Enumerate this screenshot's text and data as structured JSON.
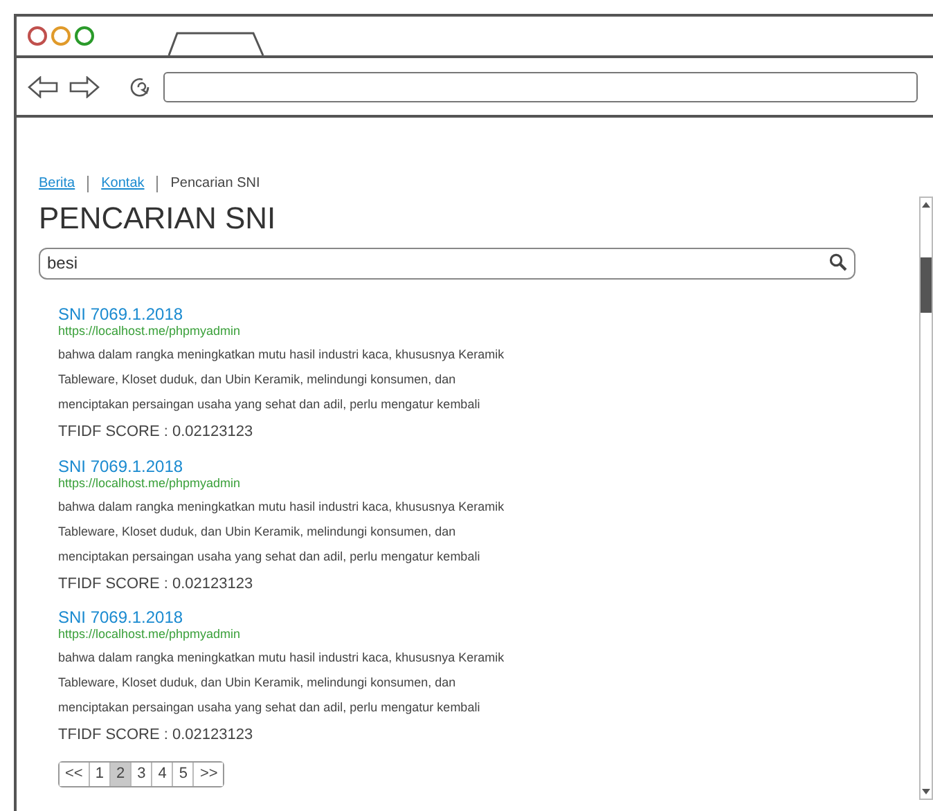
{
  "breadcrumb": [
    {
      "label": "Berita",
      "kind": "link"
    },
    {
      "label": "Kontak",
      "kind": "link"
    },
    {
      "label": "Pencarian SNI",
      "kind": "current"
    }
  ],
  "heading": "PENCARIAN SNI",
  "search": {
    "value": "besi"
  },
  "results": [
    {
      "title": "SNI 7069.1.2018",
      "url": "https://localhost.me/phpmyadmin",
      "snippet": "bahwa dalam rangka meningkatkan mutu hasil industri kaca, khususnya Keramik Tableware, Kloset duduk, dan Ubin Keramik, melindungi konsumen, dan menciptakan persaingan usaha yang sehat dan adil, perlu mengatur kembali",
      "score": "TFIDF SCORE : 0.02123123"
    },
    {
      "title": "SNI 7069.1.2018",
      "url": "https://localhost.me/phpmyadmin",
      "snippet": "bahwa dalam rangka meningkatkan mutu hasil industri kaca, khususnya Keramik Tableware, Kloset duduk, dan Ubin Keramik, melindungi konsumen, dan menciptakan persaingan usaha yang sehat dan adil, perlu mengatur kembali",
      "score": "TFIDF SCORE : 0.02123123"
    },
    {
      "title": "SNI 7069.1.2018",
      "url": "https://localhost.me/phpmyadmin",
      "snippet": "bahwa dalam rangka meningkatkan mutu hasil industri kaca, khususnya Keramik Tableware, Kloset duduk, dan Ubin Keramik, melindungi konsumen, dan menciptakan persaingan usaha yang sehat dan adil, perlu mengatur kembali",
      "score": "TFIDF SCORE : 0.02123123"
    }
  ],
  "pagination": [
    {
      "label": "<<",
      "selected": false
    },
    {
      "label": "1",
      "selected": false
    },
    {
      "label": "2",
      "selected": true
    },
    {
      "label": "3",
      "selected": false
    },
    {
      "label": "4",
      "selected": false
    },
    {
      "label": "5",
      "selected": false
    },
    {
      "label": ">>",
      "selected": false
    }
  ]
}
